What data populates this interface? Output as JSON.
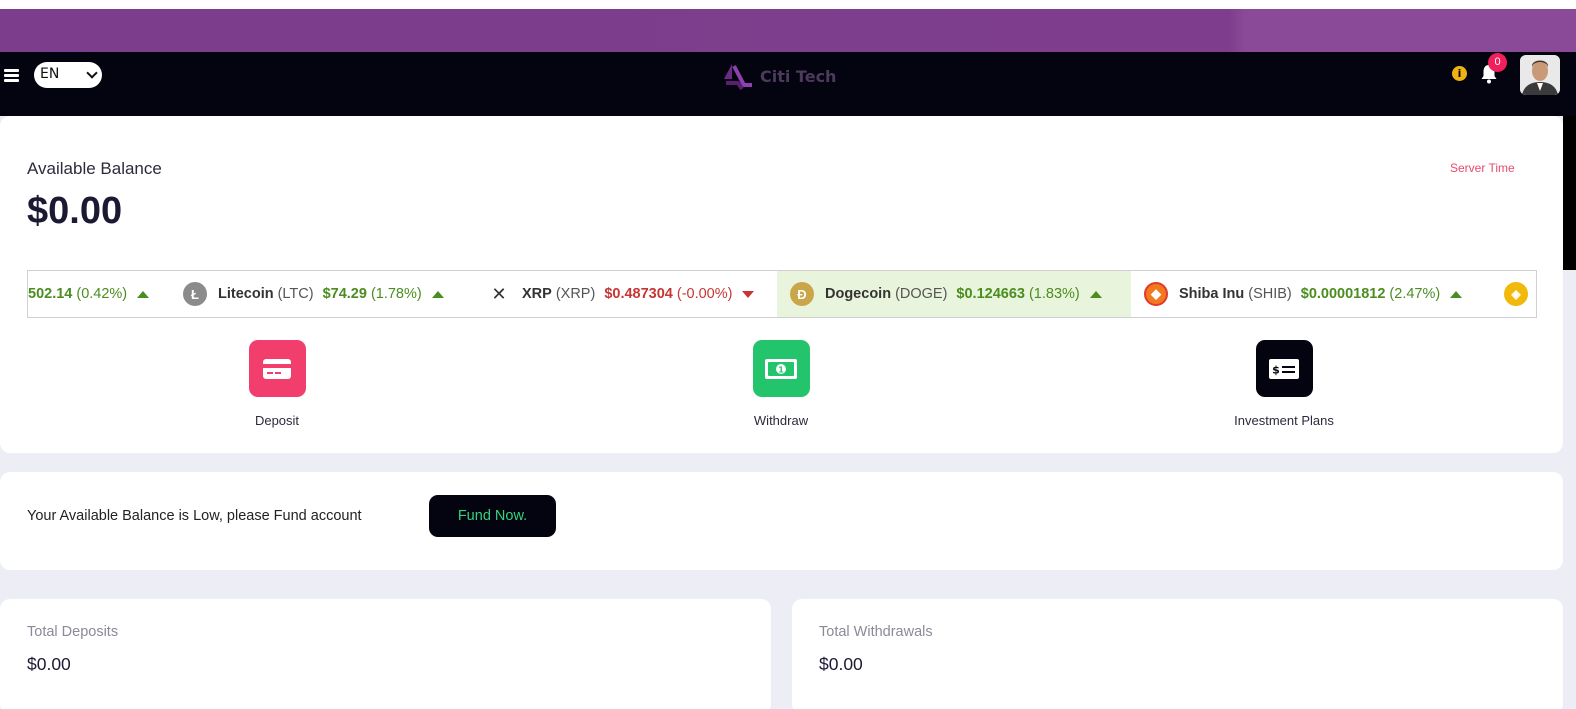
{
  "header": {
    "language": "EN",
    "brand": "Citi Tech",
    "notification_count": "0",
    "info_glyph": "i"
  },
  "balance": {
    "label": "Available Balance",
    "value": "$0.00",
    "server_time_label": "Server Time"
  },
  "ticker": [
    {
      "name": "",
      "symbol": "",
      "price": "502.14",
      "change": "(0.42%)",
      "direction": "up",
      "icon": "partial"
    },
    {
      "name": "Litecoin",
      "symbol": "(LTC)",
      "price": "$74.29",
      "change": "(1.78%)",
      "direction": "up",
      "icon": "litecoin-icon"
    },
    {
      "name": "XRP",
      "symbol": "(XRP)",
      "price": "$0.487304",
      "change": "(-0.00%)",
      "direction": "down",
      "icon": "xrp-icon"
    },
    {
      "name": "Dogecoin",
      "symbol": "(DOGE)",
      "price": "$0.124663",
      "change": "(1.83%)",
      "direction": "up",
      "icon": "dogecoin-icon"
    },
    {
      "name": "Shiba Inu",
      "symbol": "(SHIB)",
      "price": "$0.00001812",
      "change": "(2.47%)",
      "direction": "up",
      "icon": "shiba-inu-icon"
    }
  ],
  "actions": {
    "deposit": "Deposit",
    "withdraw": "Withdraw",
    "plans": "Investment Plans"
  },
  "low_balance": {
    "message": "Your Available Balance is Low, please Fund account",
    "button": "Fund Now."
  },
  "stats": {
    "deposits_label": "Total Deposits",
    "deposits_value": "$0.00",
    "withdrawals_label": "Total Withdrawals",
    "withdrawals_value": "$0.00"
  },
  "colors": {
    "accent_purple": "#7b3d8c",
    "topbar": "#03040f",
    "deposit": "#f23e6c",
    "withdraw": "#23c46b",
    "up": "#4b8d1f",
    "down": "#c73636"
  }
}
